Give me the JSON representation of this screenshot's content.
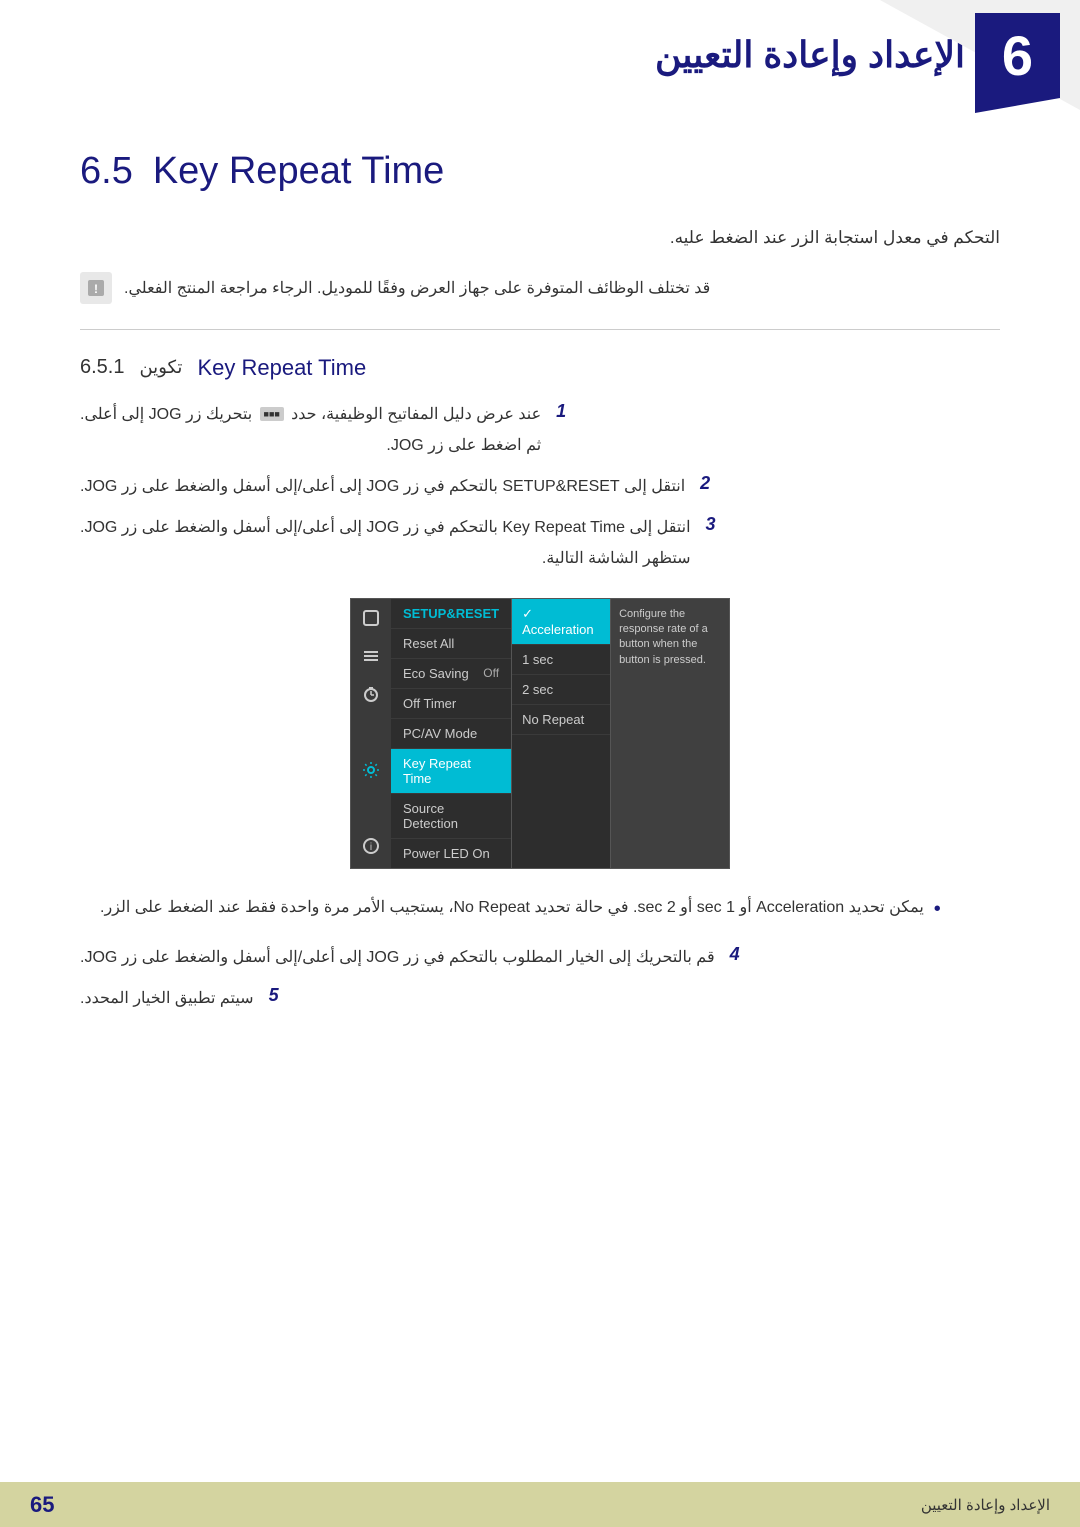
{
  "chapter": {
    "number": "6",
    "title_arabic": "الإعداد وإعادة التعيين"
  },
  "section": {
    "number": "6.5",
    "title_en": "Key Repeat Time",
    "description_arabic": "التحكم في معدل استجابة الزر  عند الضغط عليه."
  },
  "note": {
    "text": "قد تختلف الوظائف المتوفرة على جهاز العرض وفقًا للموديل. الرجاء مراجعة المنتج الفعلي."
  },
  "subsection": {
    "number": "6.5.1",
    "title_arabic": "تكوين",
    "title_en": "Key Repeat Time"
  },
  "steps": [
    {
      "number": "1",
      "text": "عند عرض دليل المفاتيح الوظيفية، حدد [■■■] بتحريك زر JOG إلى أعلى.",
      "sub_text": "ثم اضغط على زر JOG."
    },
    {
      "number": "2",
      "text": "انتقل إلى SETUP&RESET بالتحكم في زر JOG إلى أعلى/إلى أسفل والضغط على زر JOG."
    },
    {
      "number": "3",
      "text": "انتقل إلى Key Repeat Time بالتحكم في زر JOG إلى أعلى/إلى أسفل والضغط على زر JOG.",
      "sub_text": "ستظهر الشاشة التالية."
    }
  ],
  "menu": {
    "header": "SETUP&RESET",
    "items": [
      {
        "label": "Reset All",
        "icon": "square"
      },
      {
        "label": "Eco Saving",
        "icon": "lines",
        "value": "Off"
      },
      {
        "label": "Off Timer",
        "icon": "clock"
      },
      {
        "label": "PC/AV Mode",
        "icon": "none"
      },
      {
        "label": "Key Repeat Time",
        "icon": "gear",
        "highlighted": true
      },
      {
        "label": "Source Detection",
        "icon": "none"
      },
      {
        "label": "Power LED On",
        "icon": "info"
      }
    ],
    "submenu": [
      {
        "label": "Acceleration",
        "highlighted": true
      },
      {
        "label": "1 sec"
      },
      {
        "label": "2 sec"
      },
      {
        "label": "No Repeat"
      }
    ],
    "tooltip": "Configure the response rate of a button when the button is pressed."
  },
  "bullet": {
    "text_main": "يمكن تحديد Acceleration أو sec 1 أو sec 2. في حالة تحديد No Repeat، يستجيب الأمر مرة واحدة فقط عند الضغط على الزر."
  },
  "steps_continued": [
    {
      "number": "4",
      "text": "قم بالتحريك إلى الخيار المطلوب بالتحكم في زر JOG إلى أعلى/إلى أسفل والضغط على زر JOG."
    },
    {
      "number": "5",
      "text": "سيتم تطبيق الخيار المحدد."
    }
  ],
  "footer": {
    "page_number": "65",
    "chapter_arabic": "الإعداد وإعادة التعيين"
  }
}
